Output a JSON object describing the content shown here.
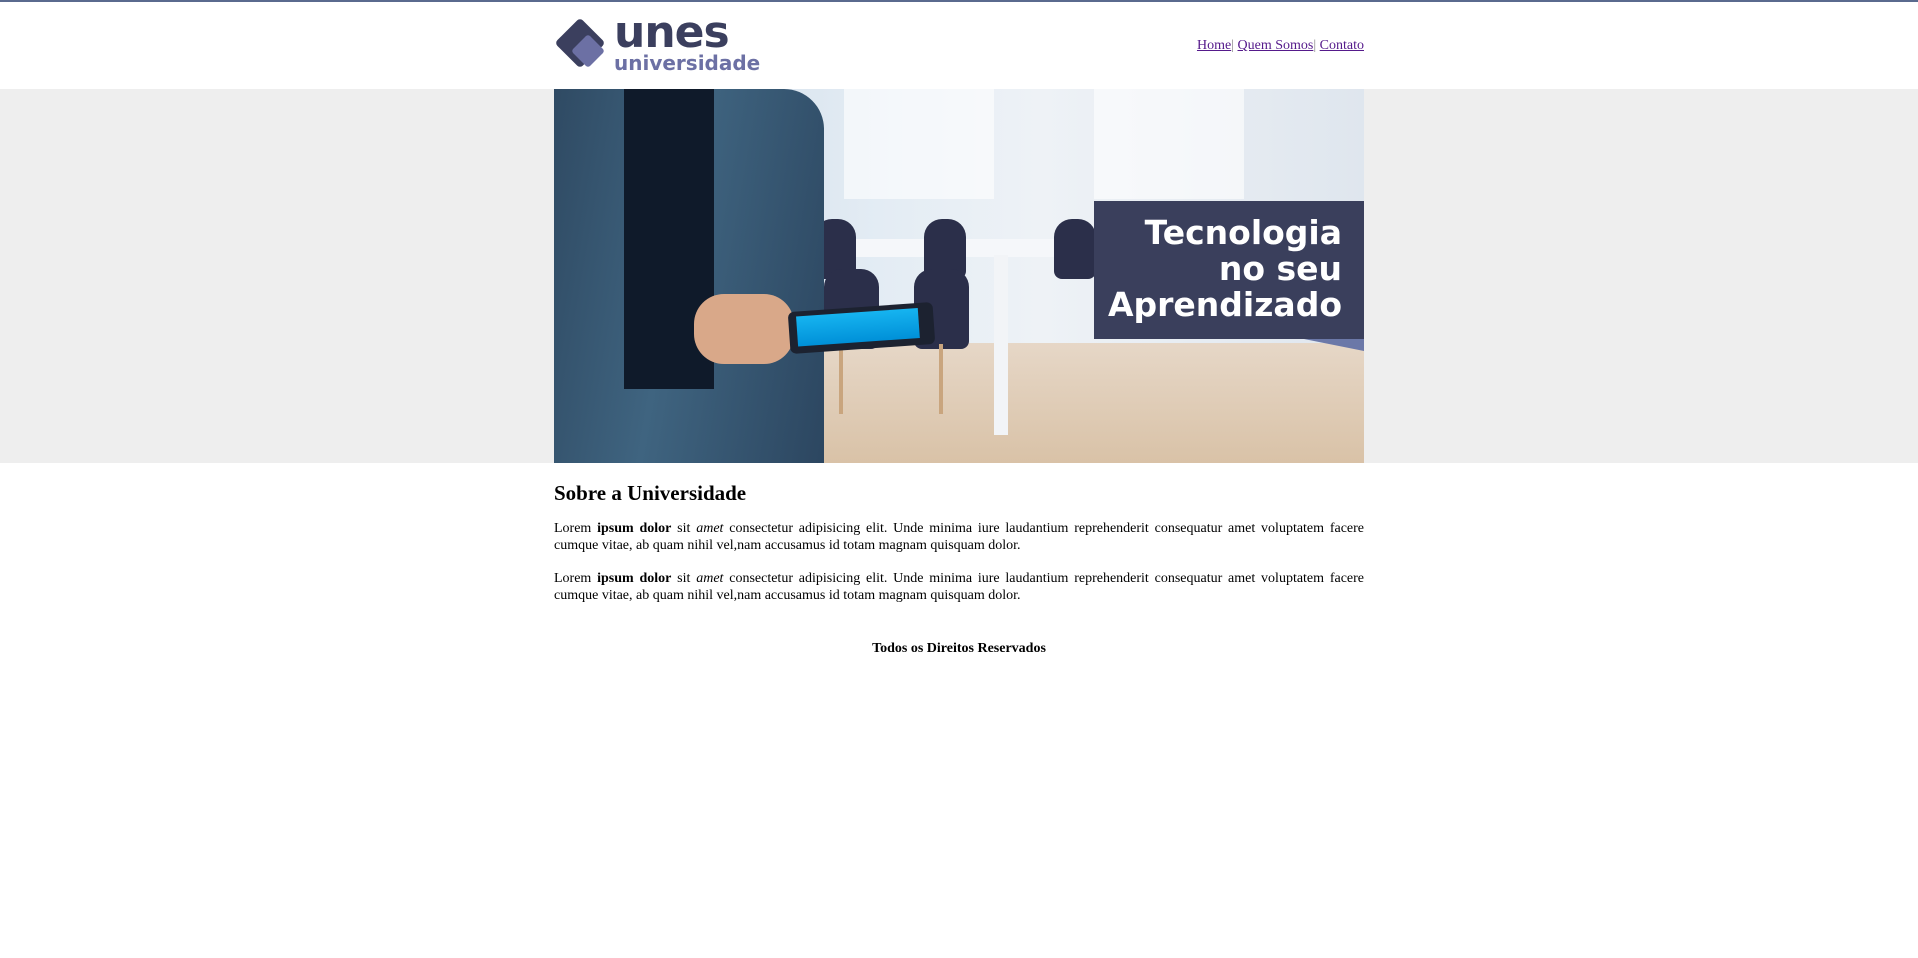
{
  "header": {
    "logo": {
      "primary": "unes",
      "secondary": "universidade"
    },
    "nav": {
      "items": [
        {
          "label": "Home"
        },
        {
          "label": "Quem Somos"
        },
        {
          "label": "Contato"
        }
      ],
      "separator": "|"
    }
  },
  "banner": {
    "headline": [
      "Tecnologia",
      "no seu",
      "Aprendizado"
    ]
  },
  "main": {
    "title": "Sobre a Universidade",
    "paragraphs": [
      {
        "part1": "Lorem ",
        "bold": "ipsum dolor",
        "part2": " sit ",
        "italic": "amet",
        "part3": " consectetur adipisicing elit. Unde minima iure laudantium reprehenderit consequatur amet voluptatem facere cumque vitae, ab quam nihil vel,nam accusamus id totam magnam quisquam dolor."
      },
      {
        "part1": "Lorem ",
        "bold": "ipsum dolor",
        "part2": " sit ",
        "italic": "amet",
        "part3": " consectetur adipisicing elit. Unde minima iure laudantium reprehenderit consequatur amet voluptatem facere cumque vitae, ab quam nihil vel,nam accusamus id totam magnam quisquam dolor."
      }
    ]
  },
  "footer": {
    "text": "Todos os Direitos Reservados"
  },
  "colors": {
    "brand_dark": "#3b3f5e",
    "brand_light": "#6c70a4",
    "banner_box": "#3a3f5c",
    "banner_strip": "#eeeeee"
  }
}
